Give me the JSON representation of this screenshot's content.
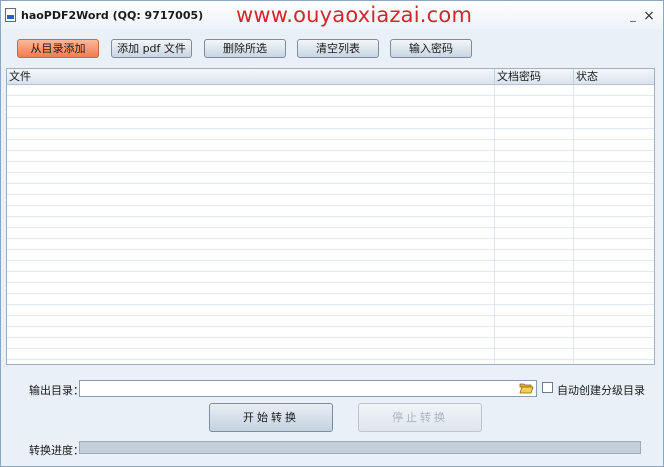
{
  "window": {
    "title": "haoPDF2Word (QQ: 9717005)",
    "watermark": "www.ouyaoxiazai.com",
    "minimize_glyph": "_",
    "close_glyph": "×"
  },
  "toolbar": {
    "add_from_dir": "从目录添加",
    "add_pdf": "添加 pdf 文件",
    "delete_selected": "删除所选",
    "clear_list": "清空列表",
    "enter_password": "输入密码"
  },
  "table": {
    "columns": [
      "文件",
      "文档密码",
      "状态"
    ],
    "rows": []
  },
  "output": {
    "label": "输出目录：",
    "value": "",
    "folder_icon": "folder-open-icon",
    "auto_create_label": "自动创建分级目录",
    "auto_create_checked": false
  },
  "actions": {
    "start": "开始转换",
    "stop": "停止转换",
    "stop_enabled": false
  },
  "progress": {
    "label": "转换进度：",
    "value": 0
  },
  "colors": {
    "active_button": "#f27c50",
    "watermark": "#d0282c",
    "background": "#e9f0f8"
  }
}
